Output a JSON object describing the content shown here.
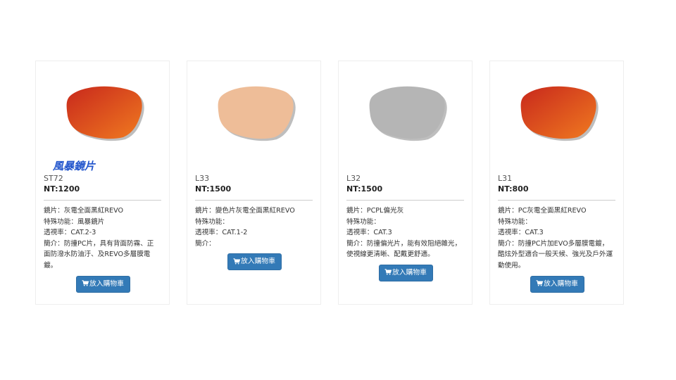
{
  "colors": {
    "button": "#337ab7",
    "tag": "#2255cc",
    "lens_red_orange_start": "#c8281c",
    "lens_red_orange_end": "#f07a20",
    "lens_peach": "#eebd98",
    "lens_gray": "#b5b5b5"
  },
  "products": [
    {
      "tag": "風暴鏡片",
      "model": "ST72",
      "price": "NT:1200",
      "lens_color": "red-orange",
      "lines": [
        "鏡片：灰電全面黑紅REVO",
        "特殊功能：風暴鏡片",
        "透視率：CAT.2-3",
        "簡介：防撞PC片，具有背面防霧、正",
        "面防潑水防油汙、及REVO多層膜電",
        "鍍。"
      ],
      "button_label": "放入購物車",
      "button_icon": "shopping-cart-icon"
    },
    {
      "tag": "",
      "model": "L33",
      "price": "NT:1500",
      "lens_color": "peach",
      "lines": [
        "鏡片：變色片灰電全面黑紅REVO",
        "特殊功能：",
        "透視率：CAT.1-2",
        "簡介："
      ],
      "button_label": "放入購物車",
      "button_icon": "shopping-cart-icon"
    },
    {
      "tag": "",
      "model": "L32",
      "price": "NT:1500",
      "lens_color": "gray",
      "lines": [
        "鏡片：PCPL偏光灰",
        "特殊功能：",
        "透視率：CAT.3",
        "簡介：防撞偏光片，能有效阻絕雜光，",
        "使視線更清晰、配戴更舒適。"
      ],
      "button_label": "放入購物車",
      "button_icon": "shopping-cart-icon"
    },
    {
      "tag": "",
      "model": "L31",
      "price": "NT:800",
      "lens_color": "red-orange",
      "lines": [
        "鏡片：PC灰電全面黑紅REVO",
        "特殊功能：",
        "透視率：CAT.3",
        "簡介：防撞PC片加EVO多層膜電鍍，",
        "酷炫外型適合一般天候、強光及戶外運",
        "動使用。"
      ],
      "button_label": "放入購物車",
      "button_icon": "shopping-cart-icon"
    }
  ]
}
